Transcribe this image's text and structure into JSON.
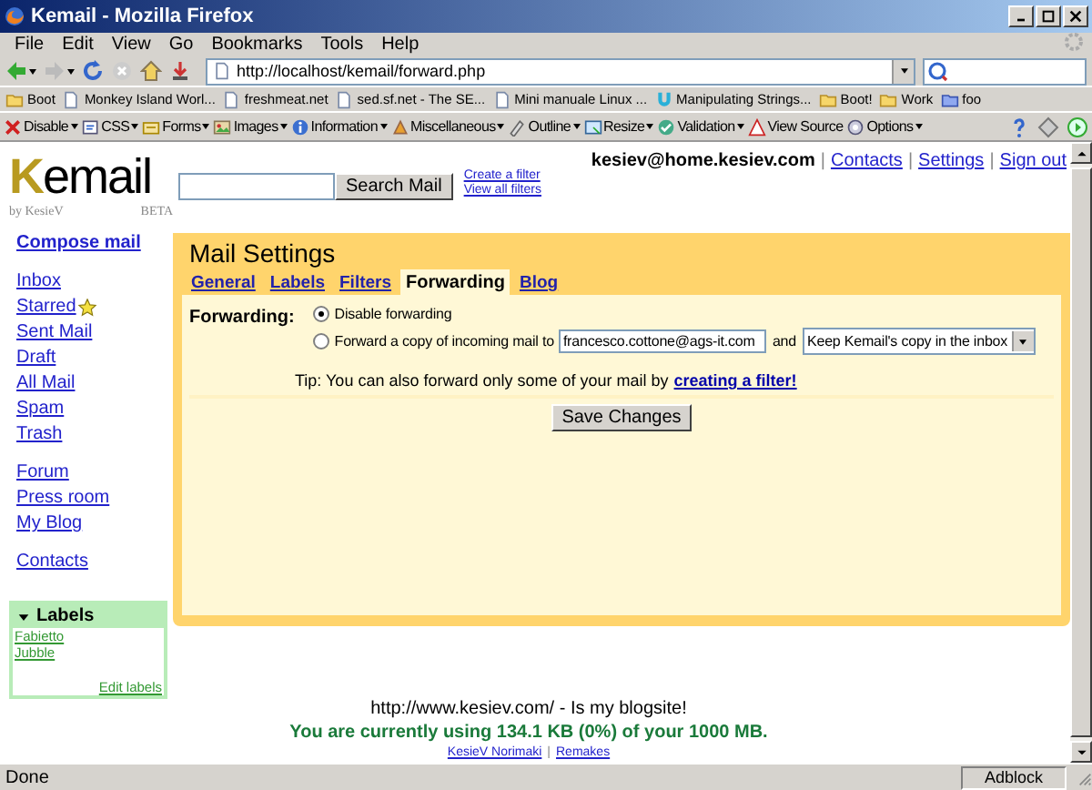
{
  "window": {
    "title": "Kemail - Mozilla Firefox"
  },
  "menu": [
    "File",
    "Edit",
    "View",
    "Go",
    "Bookmarks",
    "Tools",
    "Help"
  ],
  "address": {
    "url": "http://localhost/kemail/forward.php"
  },
  "bookmarks": [
    {
      "label": "Boot",
      "kind": "folder"
    },
    {
      "label": "Monkey Island Worl...",
      "kind": "page"
    },
    {
      "label": "freshmeat.net",
      "kind": "page"
    },
    {
      "label": "sed.sf.net - The SE...",
      "kind": "page"
    },
    {
      "label": "Mini manuale Linux ...",
      "kind": "page"
    },
    {
      "label": "Manipulating Strings...",
      "kind": "special"
    },
    {
      "label": "Boot!",
      "kind": "folder"
    },
    {
      "label": "Work",
      "kind": "folder"
    },
    {
      "label": "foo",
      "kind": "feed"
    }
  ],
  "dev_toolbar": [
    {
      "label": "Disable",
      "dropdown": true
    },
    {
      "label": "CSS",
      "dropdown": true
    },
    {
      "label": "Forms",
      "dropdown": true
    },
    {
      "label": "Images",
      "dropdown": true
    },
    {
      "label": "Information",
      "dropdown": true
    },
    {
      "label": "Miscellaneous",
      "dropdown": true
    },
    {
      "label": "Outline",
      "dropdown": true
    },
    {
      "label": "Resize",
      "dropdown": true
    },
    {
      "label": "Validation",
      "dropdown": true
    },
    {
      "label": "View Source",
      "dropdown": false
    },
    {
      "label": "Options",
      "dropdown": true
    }
  ],
  "logo": {
    "text": "Kemail",
    "tagline": "by KesieV",
    "badge": "BETA"
  },
  "search": {
    "button": "Search Mail",
    "links": [
      "Create a filter",
      "View all filters"
    ]
  },
  "user": {
    "email": "kesiev@home.kesiev.com",
    "separator": "|",
    "links": [
      "Contacts",
      "Settings",
      "Sign out"
    ]
  },
  "sidebar": {
    "groups": [
      [
        {
          "label": "Compose mail",
          "kind": "primary"
        }
      ],
      [
        {
          "label": "Inbox",
          "kind": "plain"
        },
        {
          "label": "Starred",
          "kind": "starred"
        },
        {
          "label": "Sent Mail",
          "kind": "plain"
        },
        {
          "label": "Draft",
          "kind": "plain"
        },
        {
          "label": "All Mail",
          "kind": "plain"
        },
        {
          "label": "Spam",
          "kind": "plain"
        },
        {
          "label": "Trash",
          "kind": "plain"
        }
      ],
      [
        {
          "label": "Forum",
          "kind": "plain"
        },
        {
          "label": "Press room",
          "kind": "plain"
        },
        {
          "label": "My Blog",
          "kind": "plain"
        }
      ],
      [
        {
          "label": "Contacts",
          "kind": "plain"
        }
      ]
    ],
    "labels": {
      "title": "Labels",
      "expanded": true,
      "items": [
        "Fabietto",
        "Jubble"
      ],
      "edit": "Edit labels"
    }
  },
  "settings": {
    "title": "Mail Settings",
    "tabs": [
      {
        "label": "General",
        "selected": false
      },
      {
        "label": "Labels",
        "selected": false
      },
      {
        "label": "Filters",
        "selected": false
      },
      {
        "label": "Forwarding",
        "selected": true
      },
      {
        "label": "Blog",
        "selected": false
      }
    ],
    "field_label": "Forwarding:",
    "options": [
      {
        "label": "Disable forwarding",
        "selected": true,
        "kind": "plain"
      },
      {
        "label": "Forward a copy of incoming mail to",
        "selected": false,
        "kind": "forward"
      }
    ],
    "forward_address": "francesco.cottone@ags-it.com",
    "conjunction": "and",
    "action": "Keep Kemail's copy in the inbox",
    "tip": "Tip: You can also forward only some of your mail by",
    "tip_link": "creating a filter!",
    "save": "Save Changes"
  },
  "footer": {
    "blog": "http://www.kesiev.com/ - Is my blogsite!",
    "usage": "You are currently using 134.1 KB (0%) of your 1000 MB.",
    "separator": "|",
    "links": [
      "KesieV Norimaki",
      "Remakes"
    ]
  },
  "status_bar": {
    "text": "Done",
    "panel": "Adblock"
  }
}
